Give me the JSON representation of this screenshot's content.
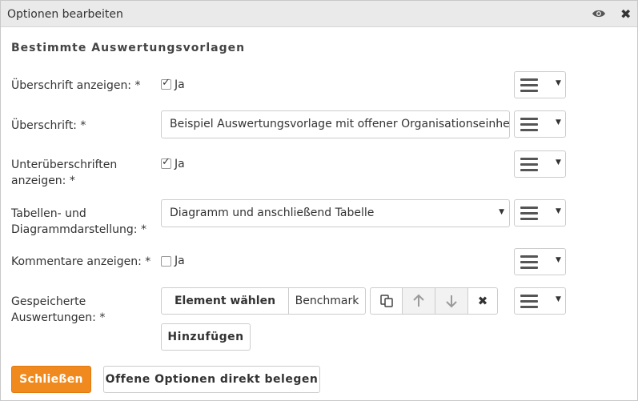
{
  "window": {
    "title": "Optionen bearbeiten",
    "eye_icon": "eye-icon",
    "close_icon": "close-icon"
  },
  "section_title": "Bestimmte Auswertungsvorlagen",
  "rows": {
    "show_heading": {
      "label": "Überschrift anzeigen: *",
      "checked": true,
      "check_label": "Ja"
    },
    "heading": {
      "label": "Überschrift: *",
      "value": "Beispiel Auswertungsvorlage mit offener Organisationseinheit"
    },
    "show_subheadings": {
      "label_line1": "Unterüberschriften",
      "label_line2": "anzeigen: *",
      "checked": true,
      "check_label": "Ja"
    },
    "table_chart": {
      "label_line1": "Tabellen- und",
      "label_line2": "Diagrammdarstellung: *",
      "value": "Diagramm und anschließend Tabelle"
    },
    "show_comments": {
      "label": "Kommentare anzeigen: *",
      "checked": false,
      "check_label": "Ja"
    },
    "saved_evaluations": {
      "label_line1": "Gespeicherte",
      "label_line2": "Auswertungen: *",
      "select_element": "Element wählen",
      "benchmark": "Benchmark",
      "add": "Hinzufügen"
    }
  },
  "footer": {
    "close": "Schließen",
    "assign_open": "Offene Optionen direkt belegen"
  },
  "colors": {
    "primary": "#f08a1e",
    "titlebar": "#eaeaea"
  }
}
